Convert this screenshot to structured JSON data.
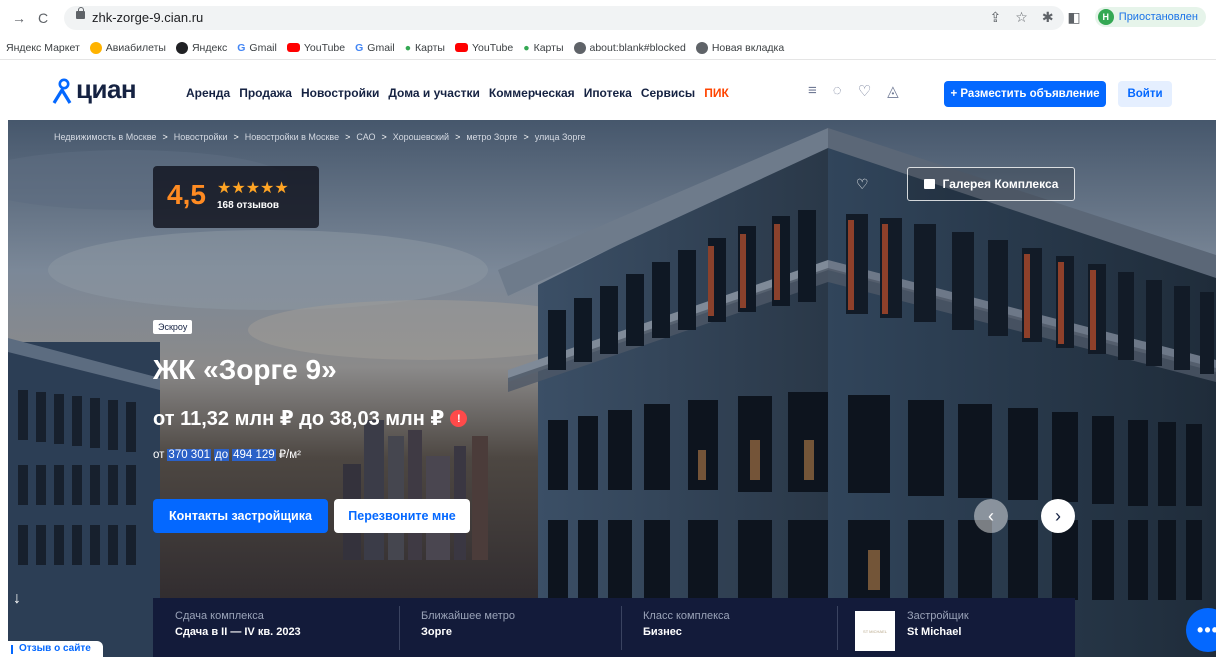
{
  "browser": {
    "url": "zhk-zorge-9.cian.ru",
    "profile_initial": "Н",
    "profile_label": "Приостановлен",
    "bookmarks": [
      "Яндекс Маркет",
      "Авиабилеты",
      "Яндекс",
      "Gmail",
      "YouTube",
      "Gmail",
      "Карты",
      "YouTube",
      "Карты",
      "about:blank#blocked",
      "Новая вкладка"
    ]
  },
  "header": {
    "logo": "циан",
    "nav": [
      "Аренда",
      "Продажа",
      "Новостройки",
      "Дома и участки",
      "Коммерческая",
      "Ипотека",
      "Сервисы"
    ],
    "pik": "ПИК",
    "post_button": "+ Разместить объявление",
    "login_button": "Войти"
  },
  "breadcrumb": [
    "Недвижимость в Москве",
    "Новостройки",
    "Новостройки в Москве",
    "САО",
    "Хорошевский",
    "метро Зорге",
    "улица Зорге"
  ],
  "rating": {
    "value": "4,5",
    "stars": "★★★★★",
    "reviews": "168 отзывов"
  },
  "gallery_button": "Галерея Комплекса",
  "escrow_badge": "Эскроу",
  "title": "ЖК «Зорге 9»",
  "price_range": "от 11,32 млн ₽ до 38,03 млн ₽",
  "price_per_m2": {
    "from_word": "от",
    "from": "370 301",
    "to_word": "до",
    "to": "494 129",
    "unit": "₽/м²"
  },
  "buttons": {
    "contacts": "Контакты застройщика",
    "callback": "Перезвоните мне"
  },
  "info": {
    "delivery_label": "Сдача комплекса",
    "delivery_value": "Сдача в II — IV кв. 2023",
    "metro_label": "Ближайшее метро",
    "metro_value": "Зорге",
    "class_label": "Класс комплекса",
    "class_value": "Бизнес",
    "developer_label": "Застройщик",
    "developer_value": "St Michael",
    "developer_logo_text": "ST MICHAEL"
  },
  "feedback_tab": "Отзыв о сайте",
  "colors": {
    "accent": "#0468ff",
    "rating": "#ff8b22",
    "info_bar": "#131b3a"
  }
}
